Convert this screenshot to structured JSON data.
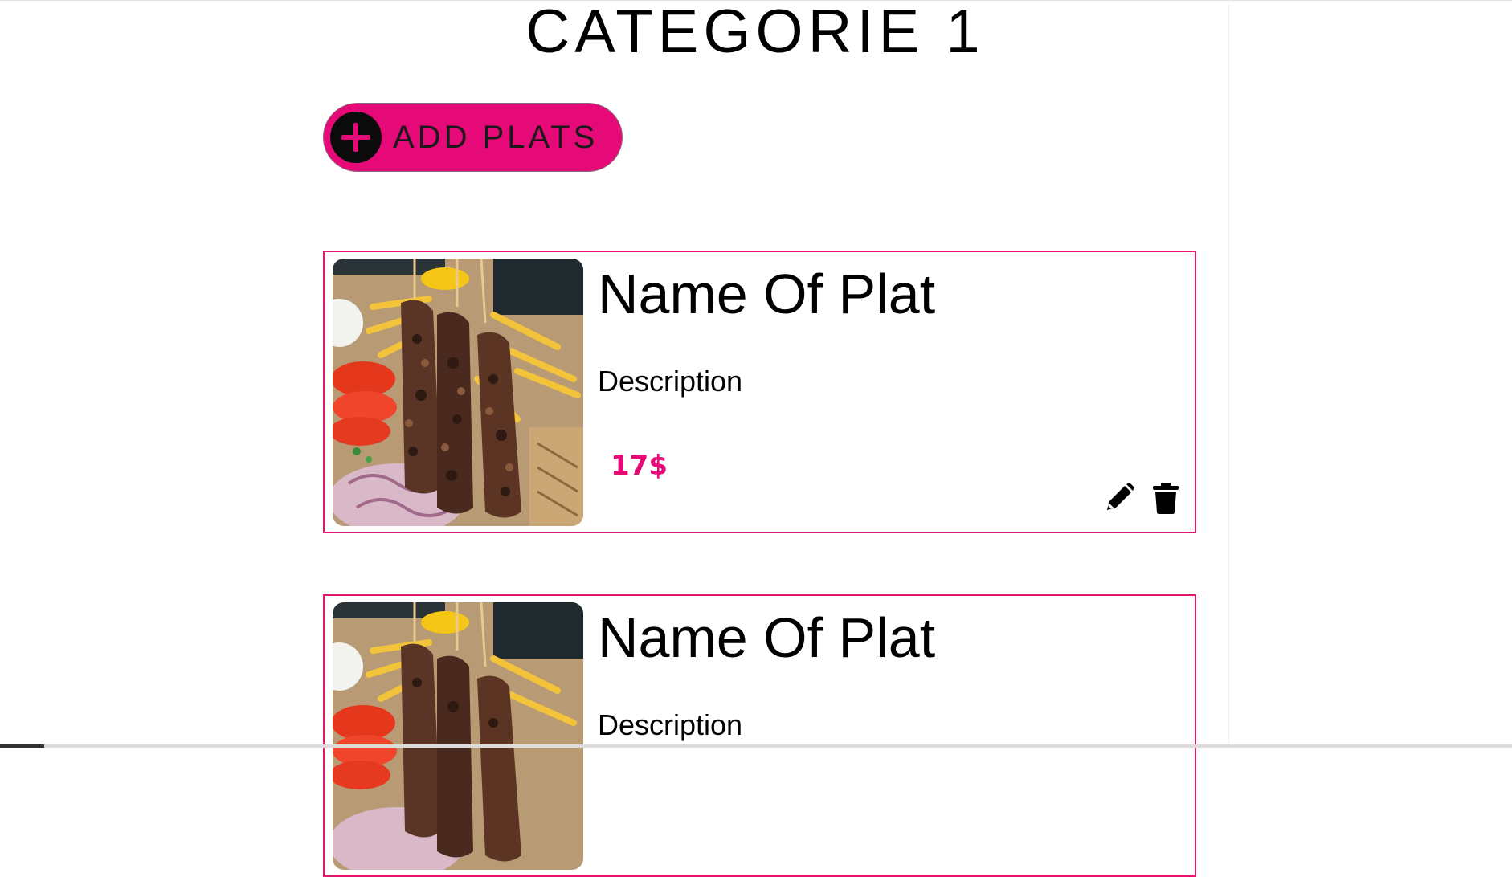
{
  "page": {
    "title": "CATEGORIE 1"
  },
  "add_button": {
    "label": "ADD PLATS",
    "icon": "plus-circle-icon"
  },
  "colors": {
    "accent": "#e60a78",
    "card_border": "#e4166f",
    "text": "#000000"
  },
  "plats": [
    {
      "name": "Name Of Plat",
      "description": "Description",
      "price": "17$",
      "image": "souvlaki-platter",
      "actions": [
        "edit-icon",
        "delete-icon"
      ]
    },
    {
      "name": "Name Of Plat",
      "description": "Description",
      "image": "souvlaki-platter"
    }
  ]
}
